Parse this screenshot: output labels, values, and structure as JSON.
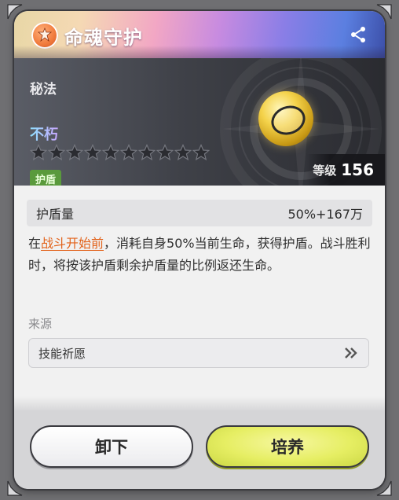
{
  "header": {
    "title": "命魂守护",
    "icon": "guardian-emblem-icon",
    "share_icon": "share-icon"
  },
  "hero": {
    "category": "秘法",
    "name": "不朽",
    "stars_filled": 0,
    "stars_total": 10,
    "tag": "护盾",
    "level_label": "等级",
    "level_value": "156",
    "relic_icon": "golden-ring-relic-icon"
  },
  "stat": {
    "label": "护盾量",
    "value": "50%+167万"
  },
  "description": {
    "prefix": "在",
    "highlight": "战斗开始前",
    "suffix": "，消耗自身50%当前生命，获得护盾。战斗胜利时，将按该护盾剩余护盾量的比例返还生命。"
  },
  "source": {
    "label": "来源",
    "item": "技能祈愿"
  },
  "buttons": {
    "unequip": "卸下",
    "train": "培养"
  },
  "colors": {
    "highlight": "#e2621a",
    "tag_bg": "#5a9a3c",
    "train_button": "#e6ee63"
  }
}
